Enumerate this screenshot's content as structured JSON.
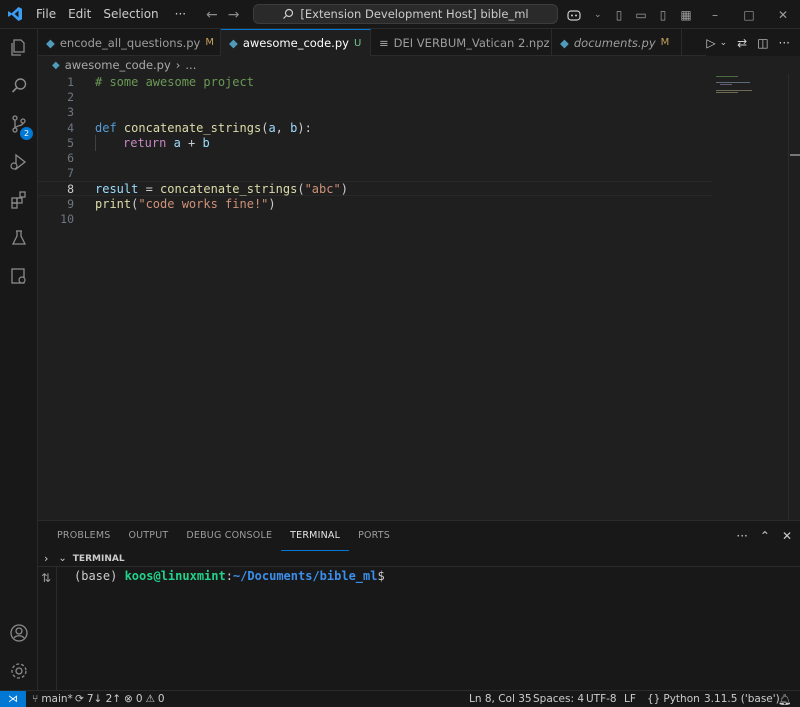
{
  "titlebar": {
    "menu": [
      "File",
      "Edit",
      "Selection",
      "···"
    ],
    "command_center": "[Extension Development Host] bible_ml"
  },
  "activity": {
    "scm_badge": "2"
  },
  "tabs": [
    {
      "label": "encode_all_questions.py",
      "status": "M",
      "italic": false
    },
    {
      "label": "awesome_code.py",
      "status": "U",
      "italic": false
    },
    {
      "label": "DEI VERBUM_Vatican 2.npz",
      "status": "",
      "italic": false
    },
    {
      "label": "documents.py",
      "status": "M",
      "italic": true
    }
  ],
  "breadcrumb": {
    "file": "awesome_code.py",
    "more": "..."
  },
  "editor": {
    "line_numbers": [
      "1",
      "2",
      "3",
      "4",
      "5",
      "6",
      "7",
      "8",
      "9",
      "10"
    ],
    "current_line": "8",
    "code": {
      "l1_comment": "# some awesome project",
      "l4_def": "def",
      "l4_fn": "concatenate_strings",
      "l4_open": "(",
      "l4_a": "a",
      "l4_comma": ", ",
      "l4_b": "b",
      "l4_close": "):",
      "l5_return": "return",
      "l5_expr_a": "a",
      "l5_plus": " + ",
      "l5_expr_b": "b",
      "l8_var": "result",
      "l8_eq": " = ",
      "l8_fn": "concatenate_strings",
      "l8_open": "(",
      "l8_str": "\"abc\"",
      "l8_close": ")",
      "l9_fn": "print",
      "l9_open": "(",
      "l9_str": "\"code works fine!\"",
      "l9_close": ")"
    }
  },
  "panel": {
    "tabs": [
      "PROBLEMS",
      "OUTPUT",
      "DEBUG CONSOLE",
      "TERMINAL",
      "PORTS"
    ],
    "active_tab": "TERMINAL",
    "terminal_title": "TERMINAL",
    "prompt_env": "(base) ",
    "prompt_user": "koos@linuxmint",
    "prompt_colon": ":",
    "prompt_path": "~/Documents/bible_ml",
    "prompt_symbol": "$"
  },
  "statusbar": {
    "branch": "main*",
    "sync": "7↓ 2↑",
    "errors": "0",
    "warnings": "0",
    "position": "Ln 8, Col 35",
    "spaces": "Spaces: 4",
    "encoding": "UTF-8",
    "eol": "LF",
    "language": "Python",
    "interpreter": "3.11.5 ('base')"
  },
  "colors": {
    "accent": "#0078d4",
    "modified": "#c4a15d",
    "untracked": "#73c991"
  }
}
